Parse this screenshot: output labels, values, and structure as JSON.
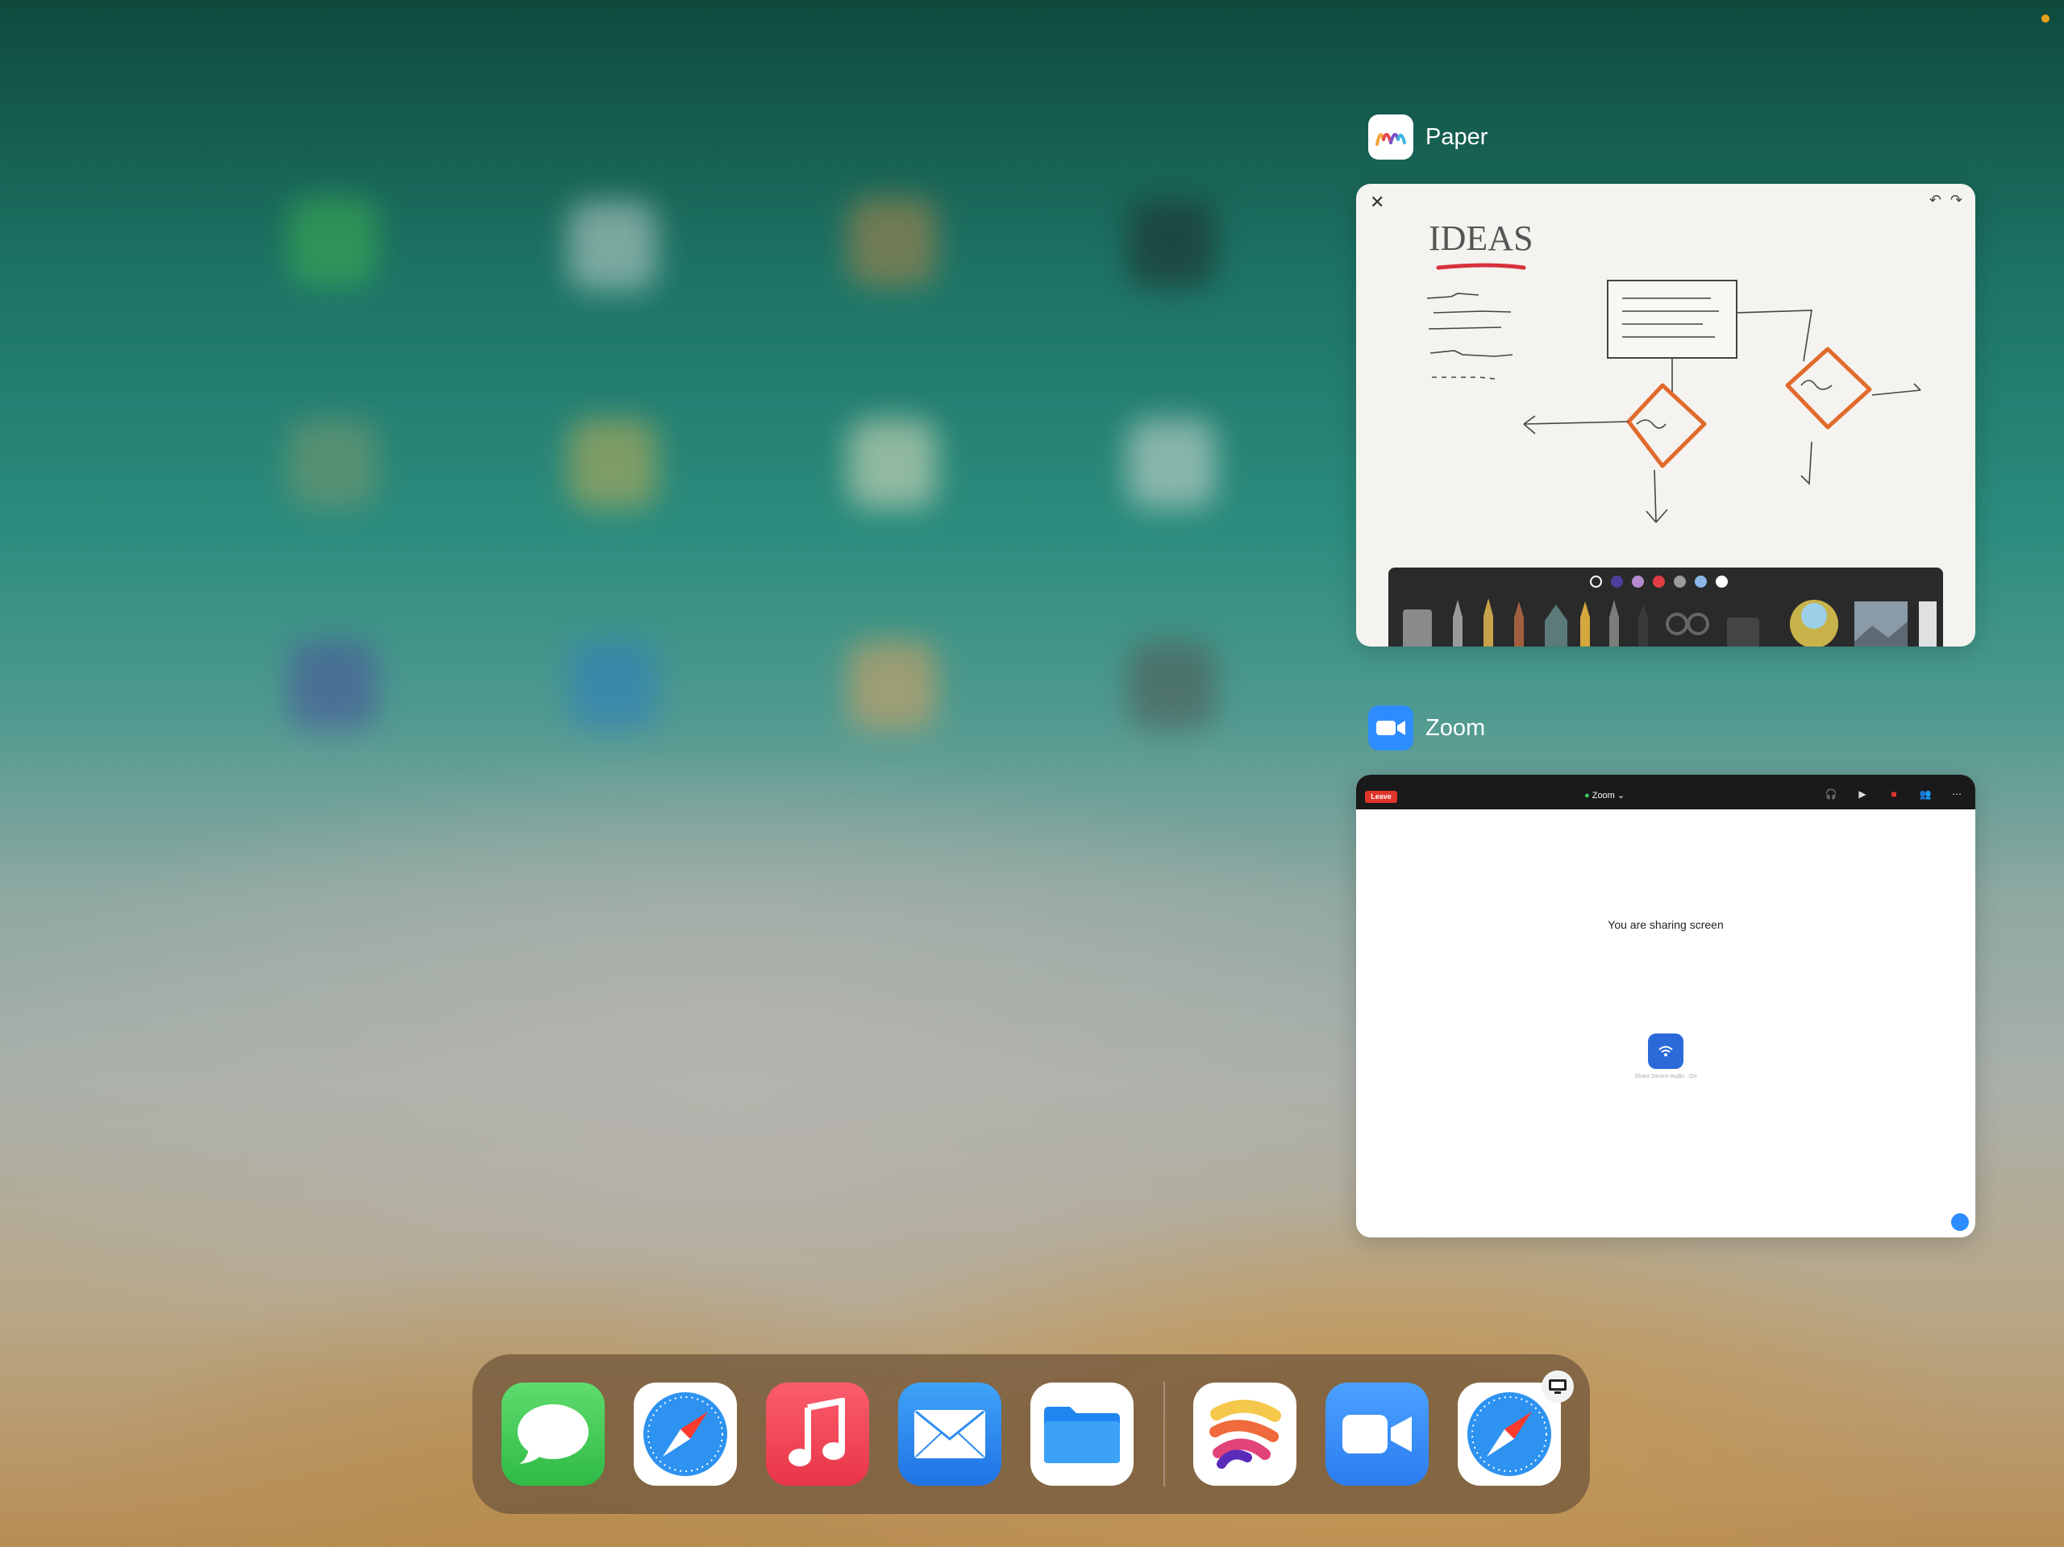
{
  "switcher": {
    "paper": {
      "app_name": "Paper",
      "canvas_text": "IDEAS",
      "swatches": [
        "#ffffff",
        "#4b3f9b",
        "#b58bd0",
        "#e23d46",
        "#9b9b9b",
        "#8ab7e6",
        "#ffffff"
      ]
    },
    "zoom": {
      "app_name": "Zoom",
      "leave_label": "Leave",
      "title": "Zoom",
      "sharing_text": "You are sharing screen",
      "share_audio_label": "Share Device Audio : On",
      "controls": [
        "Join Audio",
        "Start Video",
        "Stop Share",
        "Participants",
        "More"
      ]
    }
  },
  "dock": {
    "apps": [
      "messages-icon",
      "safari-icon",
      "music-icon",
      "mail-icon",
      "files-icon",
      "paper-icon",
      "zoom-icon",
      "safari-icon"
    ]
  },
  "colors": {
    "messages": "#3dc654",
    "music": "#f24b5e",
    "mail": "#2e8cf0",
    "files": "#1f86f0",
    "zoom": "#2d8cff",
    "status_dot": "#e8a21a"
  }
}
